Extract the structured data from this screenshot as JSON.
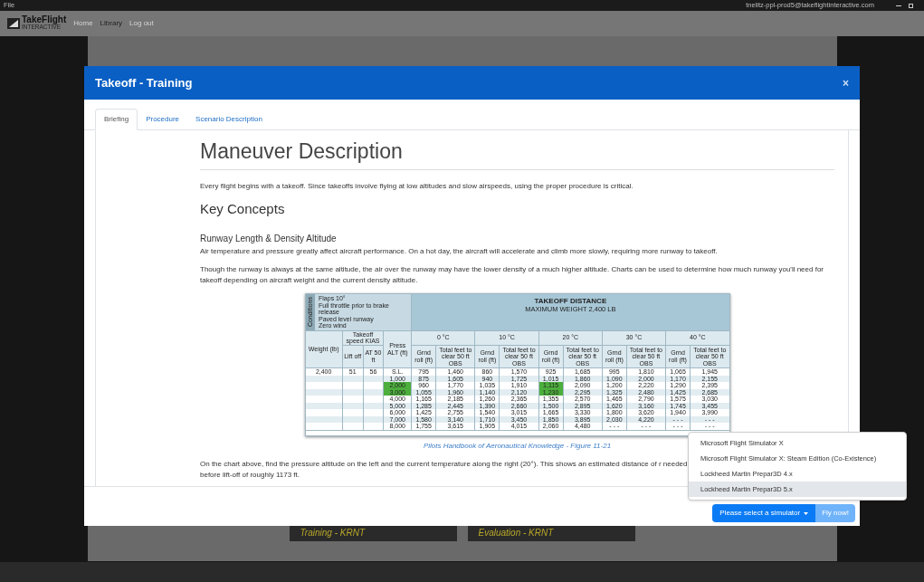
{
  "title_bar": {
    "menu": "File",
    "account": "tnelitz-ppl-prod5@takeflightinteractive.com"
  },
  "nav": {
    "logo": {
      "name": "TakeFlight",
      "sub": "INTERACTIVE"
    },
    "links": [
      {
        "label": "Home",
        "selected": false
      },
      {
        "label": "Library",
        "selected": true
      },
      {
        "label": "Log out",
        "selected": false
      }
    ]
  },
  "background_cards": [
    "Training - KRNT",
    "Evaluation - KRNT"
  ],
  "modal": {
    "title": "Takeoff - Training",
    "close": "×",
    "tabs": [
      {
        "label": "Briefing",
        "selected": true
      },
      {
        "label": "Procedure",
        "selected": false
      },
      {
        "label": "Scenario Description",
        "selected": false
      }
    ],
    "heading": "Maneuver Description",
    "intro": "Every flight begins with a takeoff. Since takeoffs involve flying at low altitudes and slow airspeeds, using the proper procedure is critical.",
    "section_heading": "Key Concepts",
    "subheading": "Runway Length & Density Altitude",
    "paragraphs": [
      "Air temperature and pressure greatly affect aircraft performance. On a hot day, the aircraft will accelerate and climb more slowly, requiring more runway to takeoff.",
      "Though the runway is always at the same altitude, the air over the runway may have the lower density of a much higher altitude. Charts can be used to determine how much runway you'll need for takeoff depending on aircraft weight and the current density altitude."
    ],
    "figure": {
      "conditions_label": "Conditions",
      "conditions": [
        "Flaps 10°",
        "Full throttle prior to brake release",
        "Paved level runway",
        "Zero wind"
      ],
      "title": "TAKEOFF DISTANCE",
      "subtitle": "MAXIMUM WEIGHT 2,400 LB",
      "weight_header": "Weight (lb)",
      "speed_header": "Takeoff speed KIAS",
      "speed_columns": [
        "Lift off",
        "AT 50 ft"
      ],
      "alt_header": "Press ALT (ft)",
      "temperatures": [
        {
          "label": "0 °C",
          "highlighted": false,
          "sub_columns": [
            "Grnd roll (ft)",
            "Total feet to clear 50 ft OBS"
          ]
        },
        {
          "label": "10 °C",
          "highlighted": false,
          "sub_columns": [
            "Grnd roll (ft)",
            "Total feet to clear 50 ft OBS"
          ]
        },
        {
          "label": "20 °C",
          "highlighted": true,
          "sub_columns": [
            "Grnd roll (ft)",
            "Total feet to clear 50 ft OBS"
          ]
        },
        {
          "label": "30 °C",
          "highlighted": false,
          "sub_columns": [
            "Grnd roll (ft)",
            "Total feet to clear 50 ft OBS"
          ]
        },
        {
          "label": "40 °C",
          "highlighted": false,
          "sub_columns": [
            "Grnd roll (ft)",
            "Total feet to clear 50 ft OBS"
          ]
        }
      ],
      "weight": "2,400",
      "lift_off": "51",
      "at_50": "56",
      "rows": [
        {
          "alt": "S.L.",
          "highlighted": false,
          "values": [
            "795",
            "1,460",
            "860",
            "1,570",
            "925",
            "1,685",
            "995",
            "1,810",
            "1,065",
            "1,945"
          ]
        },
        {
          "alt": "1,000",
          "highlighted": false,
          "values": [
            "875",
            "1,605",
            "940",
            "1,725",
            "1,015",
            "1,860",
            "1,090",
            "2,000",
            "1,170",
            "2,155"
          ]
        },
        {
          "alt": "2,000",
          "highlighted": true,
          "values": [
            "960",
            "1,770",
            "1,035",
            "1,910",
            "1,115",
            "2,090",
            "1,200",
            "2,220",
            "1,290",
            "2,395"
          ]
        },
        {
          "alt": "3,000",
          "highlighted": true,
          "values": [
            "1,055",
            "1,960",
            "1,140",
            "2,120",
            "1,230",
            "2,295",
            "1,325",
            "2,480",
            "1,425",
            "2,685"
          ]
        },
        {
          "alt": "4,000",
          "highlighted": false,
          "values": [
            "1,165",
            "2,185",
            "1,260",
            "2,365",
            "1,355",
            "2,570",
            "1,465",
            "2,790",
            "1,575",
            "3,030"
          ]
        },
        {
          "alt": "5,000",
          "highlighted": false,
          "values": [
            "1,285",
            "2,445",
            "1,390",
            "2,660",
            "1,500",
            "2,895",
            "1,620",
            "3,160",
            "1,745",
            "3,455"
          ]
        },
        {
          "alt": "6,000",
          "highlighted": false,
          "values": [
            "1,425",
            "2,755",
            "1,540",
            "3,015",
            "1,665",
            "3,330",
            "1,800",
            "3,620",
            "1,940",
            "3,990"
          ]
        },
        {
          "alt": "7,000",
          "highlighted": false,
          "values": [
            "1,580",
            "3,140",
            "1,710",
            "3,450",
            "1,850",
            "3,895",
            "2,030",
            "4,220",
            "- - -",
            "- - -"
          ]
        },
        {
          "alt": "8,000",
          "highlighted": false,
          "values": [
            "1,755",
            "3,615",
            "1,905",
            "4,015",
            "2,060",
            "4,480",
            "- - -",
            "- - -",
            "- - -",
            "- - -"
          ]
        }
      ]
    },
    "caption": "Pilots Handbook of Aeronautical Knowledge - Figure 11-21",
    "conclusion": "On the chart above, find the pressure altitude on the left and the current temperature along the right (20°). This shows an estimated distance of r needed before lift-off of roughly 1173 ft.",
    "simulator_menu": [
      {
        "label": "Microsoft Flight Simulator X",
        "selected": false
      },
      {
        "label": "Microsoft Flight Simulator X: Steam Edition (Co-Existence)",
        "selected": false
      },
      {
        "label": "Lockheed Martin Prepar3D 4.x",
        "selected": false
      },
      {
        "label": "Lockheed Martin Prepar3D 5.x",
        "selected": true
      }
    ],
    "select_button": "Please select a simulator",
    "fly_button": {
      "label": "Fly now!",
      "disabled": true
    }
  }
}
